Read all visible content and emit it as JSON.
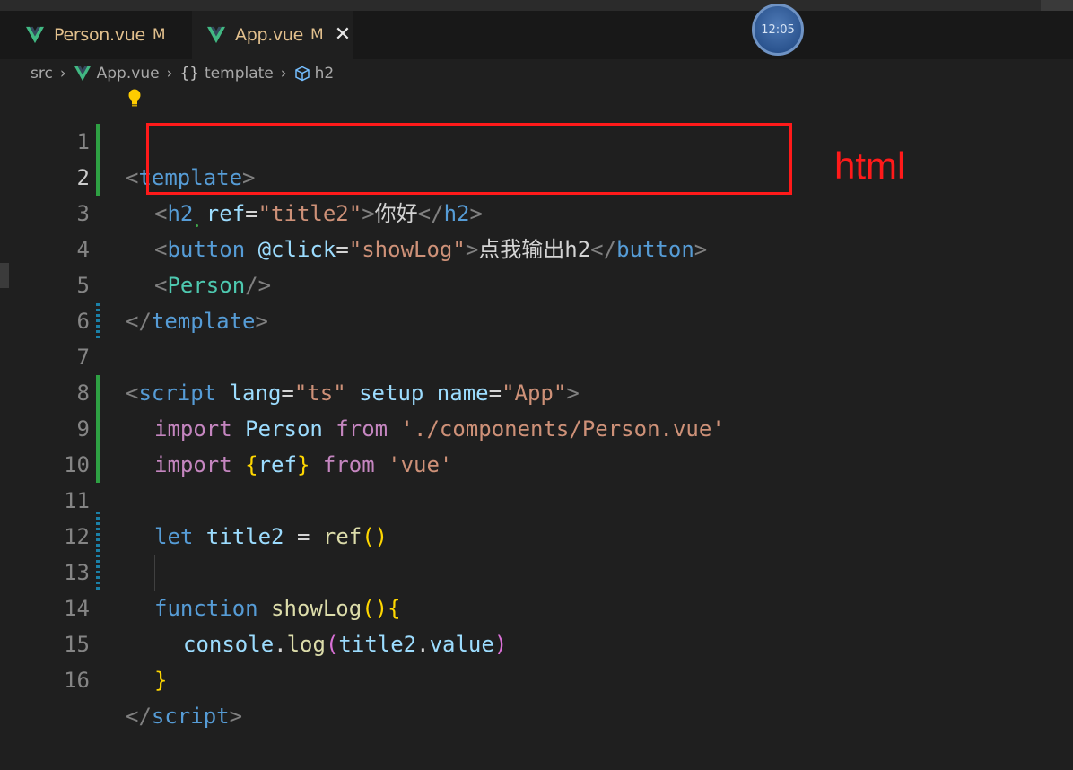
{
  "tabs": [
    {
      "name": "Person.vue",
      "modified": "M",
      "active": false
    },
    {
      "name": "App.vue",
      "modified": "M",
      "active": true,
      "close": "✕"
    }
  ],
  "clock": "12:05",
  "breadcrumb": {
    "root": "src",
    "file": "App.vue",
    "section_icon": "{}",
    "section": "template",
    "element": "h2"
  },
  "icons": {
    "vue": "vue-logo-icon",
    "braces": "braces-icon",
    "element": "cube-icon",
    "lightbulb": "lightbulb-icon"
  },
  "editor": {
    "line_numbers": [
      "1",
      "2",
      "3",
      "4",
      "5",
      "6",
      "7",
      "8",
      "9",
      "10",
      "11",
      "12",
      "13",
      "14",
      "15",
      "16"
    ],
    "lines": {
      "l1": {
        "p1": "<",
        "tag": "template",
        "p2": ">"
      },
      "l2": {
        "p1": "<",
        "tag": "h2",
        "attr": " ref",
        "eq": "=",
        "val": "\"title2\"",
        "p2": ">",
        "text": "你好",
        "p3": "</",
        "tag2": "h2",
        "p4": ">"
      },
      "l3": {
        "p1": "<",
        "tag": "button",
        "attr": " @click",
        "eq": "=",
        "val": "\"showLog\"",
        "p2": ">",
        "text": "点我输出h2",
        "p3": "</",
        "tag2": "button",
        "p4": ">"
      },
      "l4": {
        "p1": "<",
        "tag": "Person",
        "p2": "/>"
      },
      "l5": {
        "p1": "</",
        "tag": "template",
        "p2": ">"
      },
      "l7": {
        "p1": "<",
        "tag": "script",
        "attr1": " lang",
        "eq1": "=",
        "val1": "\"ts\"",
        "attr2": " setup",
        "attr3": " name",
        "eq3": "=",
        "val3": "\"App\"",
        "p2": ">"
      },
      "l8": {
        "kw": "import",
        "var": " Person ",
        "kw2": "from",
        "str": " './components/Person.vue'"
      },
      "l9": {
        "kw": "import",
        "b1": " {",
        "var": "ref",
        "b2": "}",
        "kw2": " from",
        "str": " 'vue'"
      },
      "l11": {
        "kw": "let",
        "var": " title2",
        "op": " = ",
        "fn": "ref",
        "b": "()"
      },
      "l13": {
        "kw": "function",
        "fn": " showLog",
        "b1": "()",
        "b2": "{"
      },
      "l14": {
        "var": "console",
        "dot": ".",
        "fn": "log",
        "b1": "(",
        "var2": "title2",
        "dot2": ".",
        "var3": "value",
        "b2": ")"
      },
      "l15": {
        "b": "}"
      },
      "l16": {
        "p1": "</",
        "tag": "script",
        "p2": ">"
      }
    }
  },
  "annotation": "html",
  "colors": {
    "annotation_red": "#ff1a1a",
    "vue_green": "#41b883",
    "modified": "#e2c08d"
  }
}
